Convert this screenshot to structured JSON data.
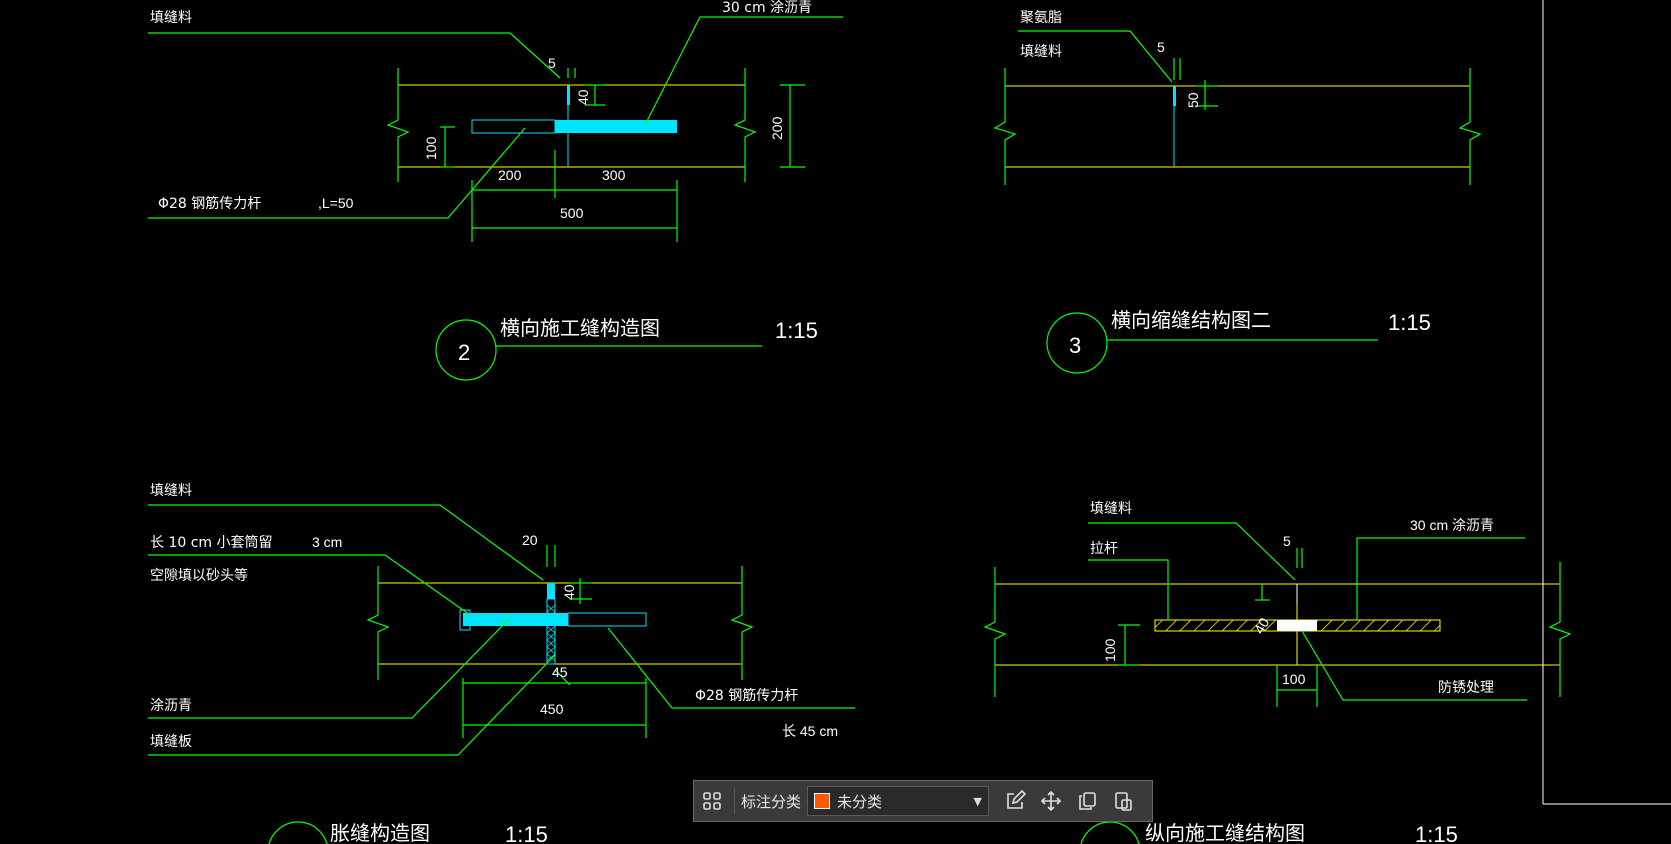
{
  "drawing": {
    "d1": {
      "fill_label": "填缝料",
      "asphalt_label": "30 cm 涂沥青",
      "bar_label": "Φ28 钢筋传力杆",
      "bar_len_label": ",L=50",
      "dim_5": "5",
      "dim_40": "40",
      "dim_100": "100",
      "dim_200_v": "200",
      "dim_200_h": "200",
      "dim_300": "300",
      "dim_500": "500",
      "number": "2",
      "title": "横向施工缝构造图",
      "scale": "1:15"
    },
    "d2": {
      "label1": "聚氨脂",
      "label2": "填缝料",
      "dim_5": "5",
      "dim_50": "50",
      "number": "3",
      "title": "横向缩缝结构图二",
      "scale": "1:15"
    },
    "d3": {
      "fill_label": "填缝料",
      "sleeve_label": "长 10 cm 小套筒留",
      "sleeve_gap": "3 cm",
      "gap_label": "空隙填以砂头等",
      "asphalt_label": "涂沥青",
      "board_label": "填缝板",
      "bar_label": "Φ28 钢筋传力杆",
      "bar_len_label": "长 45 cm",
      "dim_20": "20",
      "dim_40": "40",
      "dim_45": "45",
      "dim_450": "450",
      "title": "胀缝构造图",
      "scale": "1:15"
    },
    "d4": {
      "fill_label": "填缝料",
      "tie_label": "拉杆",
      "asphalt_label": "30 cm 涂沥青",
      "rust_label": "防锈处理",
      "dim_5": "5",
      "dim_40": "40",
      "dim_100_v": "100",
      "dim_100_h": "100",
      "title": "纵向施工缝结构图",
      "scale": "1:15"
    }
  },
  "toolbar": {
    "grid_icon": "grid-icon",
    "category_label": "标注分类",
    "category_value": "未分类",
    "swatch_color": "#ff5a00",
    "edit_icon": "edit-icon",
    "move_icon": "move-icon",
    "copy_icon": "copy-icon",
    "paste_icon": "paste-icon"
  }
}
